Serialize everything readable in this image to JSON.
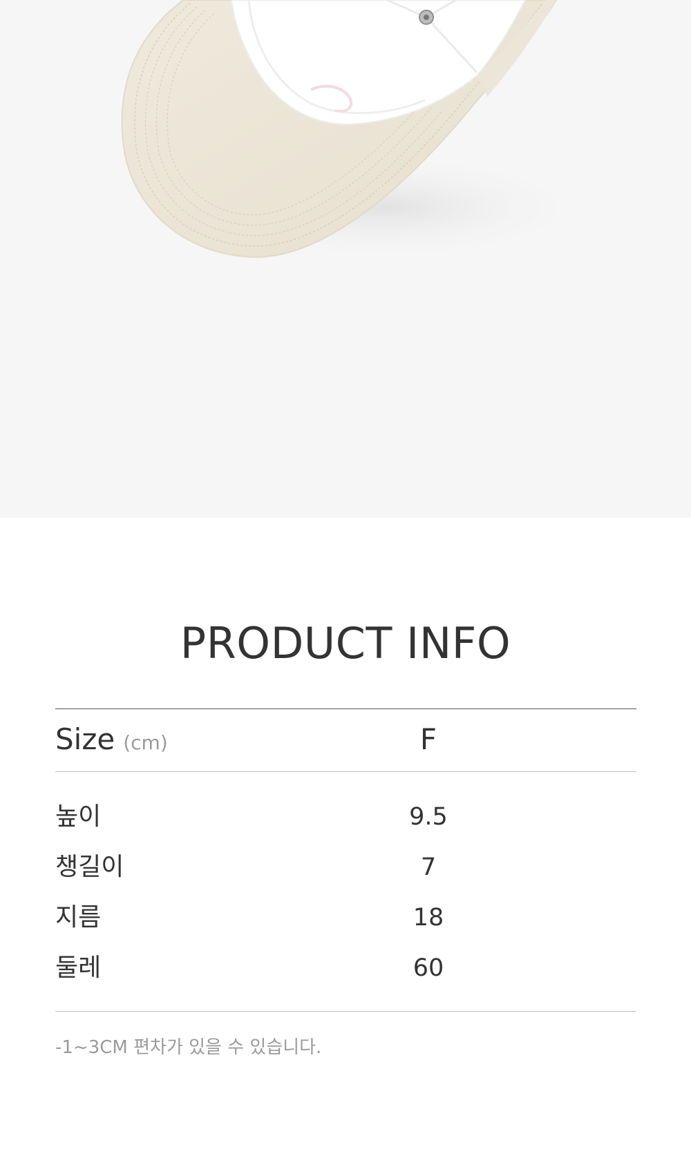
{
  "photo": {
    "alt": "cap underside image"
  },
  "title": "PRODUCT INFO",
  "table": {
    "header_label": "Size",
    "header_unit": "(cm)",
    "header_value": "F",
    "rows": [
      {
        "label": "높이",
        "value": "9.5"
      },
      {
        "label": "챙길이",
        "value": "7"
      },
      {
        "label": "지름",
        "value": "18"
      },
      {
        "label": "둘레",
        "value": "60"
      }
    ]
  },
  "note": "-1~3CM 편차가 있을 수 있습니다."
}
